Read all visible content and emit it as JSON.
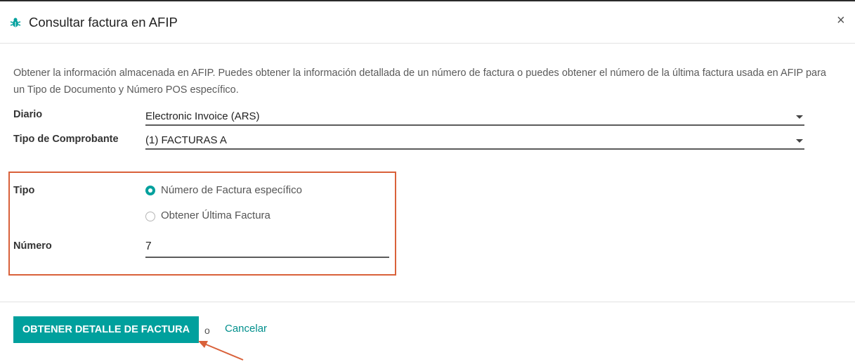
{
  "dialog": {
    "title": "Consultar factura en AFIP",
    "close_label": "×",
    "description": "Obtener la información almacenada en AFIP. Puedes obtener la información detallada de un número de factura o puedes obtener el número de la última factura usada en AFIP para un Tipo de Documento y Número POS específico."
  },
  "form": {
    "diario": {
      "label": "Diario",
      "value": "Electronic Invoice (ARS)"
    },
    "tipo_comprobante": {
      "label": "Tipo de Comprobante",
      "value": "(1) FACTURAS A"
    },
    "tipo": {
      "label": "Tipo",
      "options": [
        {
          "label": "Número de Factura específico",
          "selected": true
        },
        {
          "label": "Obtener Última Factura",
          "selected": false
        }
      ]
    },
    "numero": {
      "label": "Número",
      "value": "7"
    }
  },
  "footer": {
    "primary_button": "OBTENER DETALLE DE FACTURA",
    "or_text": "o",
    "cancel_link": "Cancelar"
  },
  "colors": {
    "accent": "#00a09d",
    "highlight": "#d9613a"
  }
}
